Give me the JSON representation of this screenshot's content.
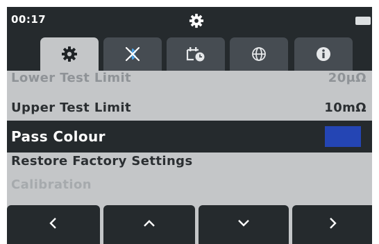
{
  "status": {
    "time": "00:17",
    "mode_icon": "gear-icon",
    "battery_icon": "battery-icon"
  },
  "tabs": [
    {
      "name": "settings",
      "icon": "gear-icon",
      "active": true
    },
    {
      "name": "bluetooth",
      "icon": "bluetooth-disabled-icon",
      "active": false
    },
    {
      "name": "date-time",
      "icon": "calendar-clock-icon",
      "active": false
    },
    {
      "name": "language",
      "icon": "globe-icon",
      "active": false
    },
    {
      "name": "info",
      "icon": "info-icon",
      "active": false
    }
  ],
  "menu": {
    "items": [
      {
        "label": "Lower Test Limit",
        "value": "20μΩ"
      },
      {
        "label": "Upper Test Limit",
        "value": "10mΩ"
      },
      {
        "label": "Pass Colour",
        "value": ""
      },
      {
        "label": "Restore Factory Settings",
        "value": ""
      },
      {
        "label": "Calibration",
        "value": ""
      }
    ],
    "selected_index": 2,
    "pass_colour": "#2445b4"
  },
  "nav": [
    {
      "name": "left",
      "icon": "chevron-left-icon"
    },
    {
      "name": "up",
      "icon": "chevron-up-icon"
    },
    {
      "name": "down",
      "icon": "chevron-down-icon"
    },
    {
      "name": "right",
      "icon": "chevron-right-icon"
    }
  ]
}
